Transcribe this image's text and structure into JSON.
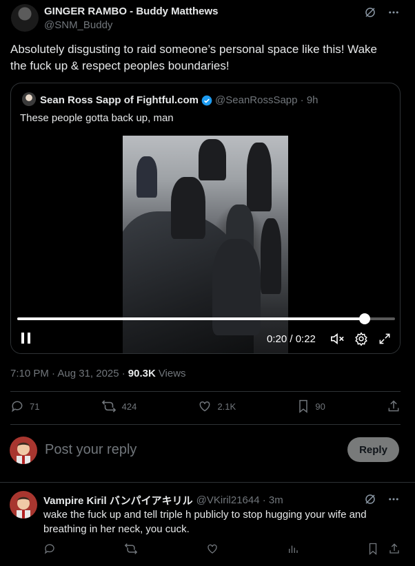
{
  "tweet": {
    "author_name": "GINGER RAMBO - Buddy Matthews",
    "author_handle": "@SNM_Buddy",
    "text": "Absolutely disgusting to raid someone’s personal space like this! Wake the fuck up & respect peoples boundaries!",
    "timestamp": "7:10 PM · Aug 31, 2025 ·",
    "views_count": "90.3K",
    "views_label": "Views"
  },
  "quote": {
    "name": "Sean Ross Sapp of Fightful.com",
    "handle_time": "@SeanRossSapp · 9h",
    "text": "These people gotta back up, man",
    "video": {
      "time": "0:20 / 0:22",
      "progress": 0.92,
      "playing": true
    }
  },
  "actions": {
    "replies": "71",
    "reposts": "424",
    "likes": "2.1K",
    "bookmarks": "90"
  },
  "reply_box": {
    "placeholder": "Post your reply",
    "button": "Reply"
  },
  "comment": {
    "name": "Vampire Kiril バンパイアキリル",
    "handle_time": "@VKiril21644 · 3m",
    "text": "wake the fuck up and tell triple h publicly to stop hugging your wife and breathing in her neck, you cuck."
  },
  "colors": {
    "background": "#000000",
    "text": "#e7e9ea",
    "secondary": "#71767b",
    "border": "#2f3336",
    "verified": "#1d9bf0",
    "reply_button": "#787a7a"
  },
  "icons": [
    "grok-icon",
    "more-icon",
    "verified-icon",
    "pause-icon",
    "mute-icon",
    "settings-icon",
    "fullscreen-icon",
    "reply-icon",
    "repost-icon",
    "like-icon",
    "bookmark-icon",
    "share-icon",
    "analytics-icon"
  ]
}
